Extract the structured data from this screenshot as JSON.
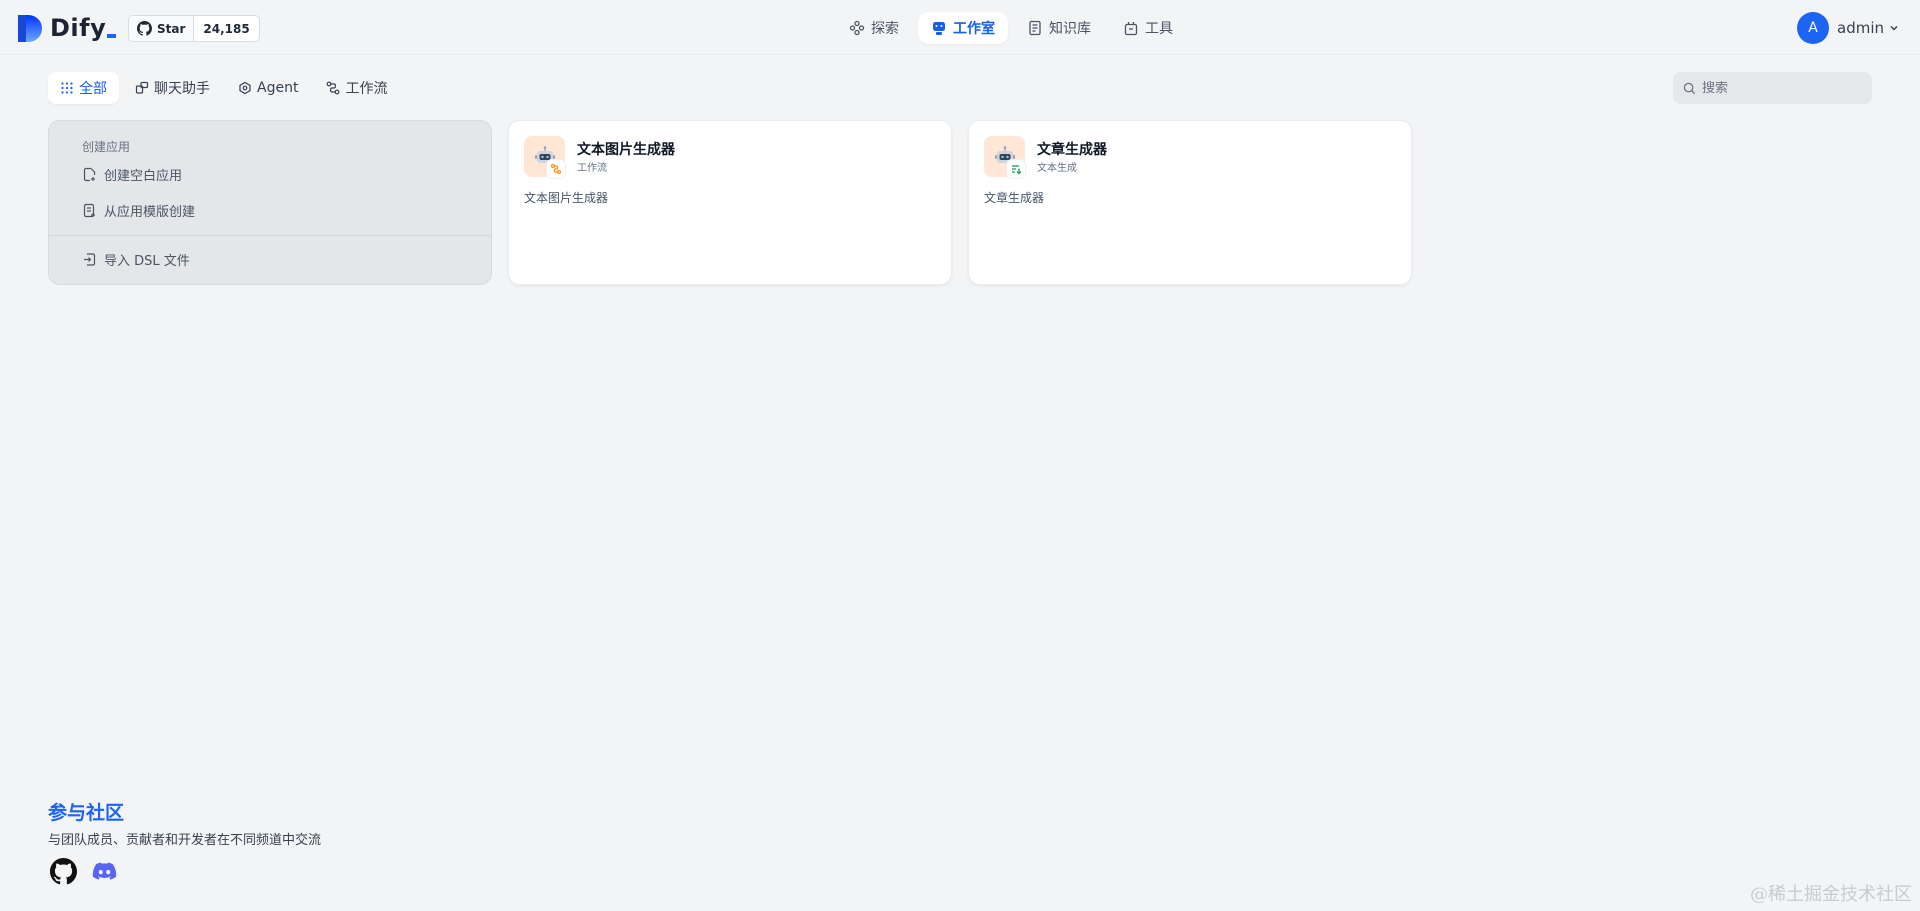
{
  "header": {
    "logo_text": "Dify",
    "github": {
      "star_label": "Star",
      "star_count": "24,185"
    },
    "nav": [
      {
        "label": "探索",
        "icon": "explore-icon",
        "active": false
      },
      {
        "label": "工作室",
        "icon": "studio-robot-icon",
        "active": true
      },
      {
        "label": "知识库",
        "icon": "knowledge-book-icon",
        "active": false
      },
      {
        "label": "工具",
        "icon": "tools-bag-icon",
        "active": false
      }
    ],
    "user": {
      "avatar_letter": "A",
      "name": "admin"
    }
  },
  "filters": {
    "tabs": [
      {
        "label": "全部",
        "icon": "grid-dots-icon",
        "active": true
      },
      {
        "label": "聊天助手",
        "icon": "chat-assistant-icon",
        "active": false
      },
      {
        "label": "Agent",
        "icon": "agent-icon",
        "active": false
      },
      {
        "label": "工作流",
        "icon": "workflow-icon",
        "active": false
      }
    ],
    "search": {
      "placeholder": "搜索"
    }
  },
  "create_card": {
    "title": "创建应用",
    "items": [
      {
        "label": "创建空白应用",
        "icon": "blank-file-add-icon"
      },
      {
        "label": "从应用模版创建",
        "icon": "template-file-icon"
      },
      {
        "label": "导入 DSL 文件",
        "icon": "import-file-icon"
      }
    ]
  },
  "apps": [
    {
      "name": "文本图片生成器",
      "type": "工作流",
      "description": "文本图片生成器",
      "badge_icon": "workflow-badge-icon",
      "badge_color": "#f79009"
    },
    {
      "name": "文章生成器",
      "type": "文本生成",
      "description": "文章生成器",
      "badge_icon": "text-generation-badge-icon",
      "badge_color": "#079455"
    }
  ],
  "community": {
    "title": "参与社区",
    "description": "与团队成员、贡献者和开发者在不同频道中交流"
  },
  "watermark": "@稀土掘金技术社区",
  "colors": {
    "accent": "#155eef",
    "brand_blue": "#1c64f2",
    "app_icon_bg": "#ffe6d5",
    "discord": "#5865f2"
  }
}
